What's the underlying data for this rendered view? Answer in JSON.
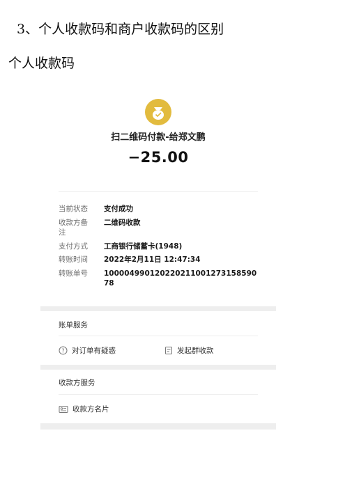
{
  "doc": {
    "heading": "3、个人收款码和商户收款码的区别",
    "subheading": "个人收款码"
  },
  "receipt": {
    "title": "扫二维码付款-给郑文鹏",
    "amount": "−25.00",
    "rows": [
      {
        "label": "当前状态",
        "value": "支付成功"
      },
      {
        "label": "收款方备注",
        "value": "二维码收款"
      },
      {
        "label": "支付方式",
        "value": "工商银行储蓄卡(1948)"
      },
      {
        "label": "转账时间",
        "value": "2022年2月11日 12:47:34"
      },
      {
        "label": "转账单号",
        "value": "100004990120220211001273158590 78"
      }
    ],
    "bill_section": {
      "title": "账单服务",
      "actions": [
        {
          "label": "对订单有疑惑",
          "icon": "question-circle-icon"
        },
        {
          "label": "发起群收款",
          "icon": "group-collect-icon"
        }
      ]
    },
    "payee_section": {
      "title": "收款方服务",
      "actions": [
        {
          "label": "收款方名片",
          "icon": "card-icon"
        }
      ]
    }
  },
  "colors": {
    "logo": "#e2bb3e",
    "band": "#eeeeee"
  }
}
